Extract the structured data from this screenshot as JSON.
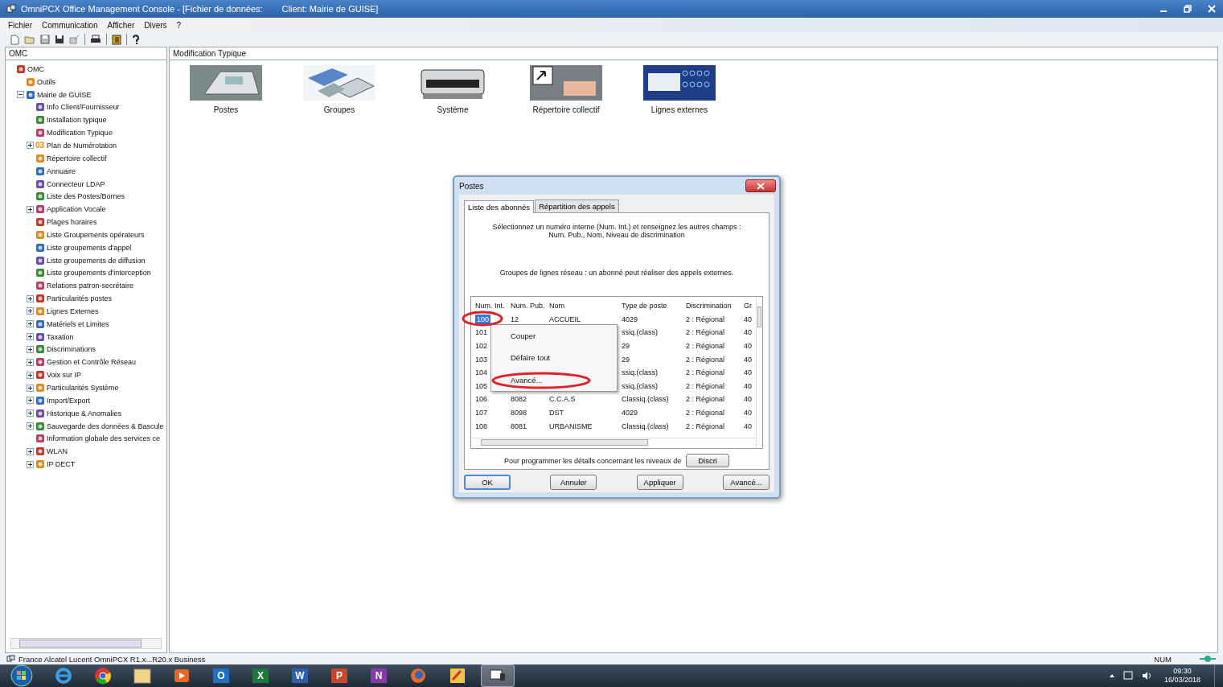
{
  "window": {
    "title": "OmniPCX Office Management Console - [Fichier de données:",
    "client": "Client:  Mairie de GUISE]"
  },
  "menu": [
    "Fichier",
    "Communication",
    "Afficher",
    "Divers",
    "?"
  ],
  "left_panel": {
    "header": "OMC"
  },
  "tree": [
    {
      "label": "OMC",
      "children": [
        {
          "label": "Outils"
        },
        {
          "label": "Mairie de GUISE",
          "expanded": true,
          "children": [
            {
              "label": "Info Client/Fournisseur"
            },
            {
              "label": "Installation typique"
            },
            {
              "label": "Modification Typique"
            },
            {
              "label": "Plan de Numérotation",
              "expanded": false,
              "icon_text": "03"
            },
            {
              "label": "Répertoire collectif"
            },
            {
              "label": "Annuaire"
            },
            {
              "label": "Connecteur LDAP"
            },
            {
              "label": "Liste des Postes/Bornes"
            },
            {
              "label": "Application Vocale",
              "expanded": false
            },
            {
              "label": "Plages horaires"
            },
            {
              "label": "Liste Groupements opérateurs"
            },
            {
              "label": "Liste groupements d'appel"
            },
            {
              "label": "Liste groupements de diffusion"
            },
            {
              "label": "Liste groupements d'interception"
            },
            {
              "label": "Relations patron-secrétaire"
            },
            {
              "label": "Particularités postes",
              "expanded": false
            },
            {
              "label": "Lignes Externes",
              "expanded": false
            },
            {
              "label": "Matériels et Limites",
              "expanded": false
            },
            {
              "label": "Taxation",
              "expanded": false
            },
            {
              "label": "Discriminations",
              "expanded": false
            },
            {
              "label": "Gestion et Contrôle Réseau",
              "expanded": false
            },
            {
              "label": "Voix sur IP",
              "expanded": false
            },
            {
              "label": "Particularités Système",
              "expanded": false
            },
            {
              "label": "Import/Export",
              "expanded": false
            },
            {
              "label": "Historique & Anomalies",
              "expanded": false
            },
            {
              "label": "Sauvegarde des données & Bascule",
              "expanded": false
            },
            {
              "label": "Information globale des services ce"
            },
            {
              "label": "WLAN",
              "expanded": false
            },
            {
              "label": "IP DECT",
              "expanded": false
            }
          ]
        }
      ]
    }
  ],
  "right_panel": {
    "header": "Modification Typique"
  },
  "features": [
    {
      "kind": "phone",
      "label": "Postes"
    },
    {
      "kind": "group",
      "label": "Groupes"
    },
    {
      "kind": "system",
      "label": "Système"
    },
    {
      "kind": "directory",
      "label": "Répertoire collectif"
    },
    {
      "kind": "lines",
      "label": "Lignes externes"
    }
  ],
  "dialog": {
    "title": "Postes",
    "tabs": [
      {
        "label": "Liste des abonnés",
        "selected": true
      },
      {
        "label": "Répartition des appels",
        "selected": false
      }
    ],
    "instructions": [
      "Sélectionnez un numéro interne (Num. Int.) et renseignez les autres champs :",
      "Num. Pub., Nom, Niveau de discrimination"
    ],
    "groups_note": "Groupes de lignes réseau : un abonné peut réaliser des appels externes.",
    "table": {
      "columns": [
        "Num. Int.",
        "Num. Pub.",
        "Nom",
        "Type de poste",
        "Discrimination",
        "Gr"
      ],
      "rows": [
        {
          "cells": [
            "100",
            "12",
            "ACCUEIL",
            "4029",
            "2 : Régional",
            "40"
          ],
          "selected": true
        },
        {
          "cells": [
            "101",
            null,
            null,
            "ssiq.(class)",
            "2 : Régional",
            "40"
          ],
          "selected": false
        },
        {
          "cells": [
            "102",
            null,
            null,
            "29",
            "2 : Régional",
            "40"
          ],
          "selected": false
        },
        {
          "cells": [
            "103",
            null,
            null,
            "29",
            "2 : Régional",
            "40"
          ],
          "selected": false
        },
        {
          "cells": [
            "104",
            null,
            null,
            "ssiq.(class)",
            "2 : Régional",
            "40"
          ],
          "selected": false
        },
        {
          "cells": [
            "105",
            null,
            null,
            "ssiq.(class)",
            "2 : Régional",
            "40"
          ],
          "selected": false
        },
        {
          "cells": [
            "106",
            "8082",
            "C.C.A.S",
            "Classiq.(class)",
            "2 : Régional",
            "40"
          ],
          "selected": false
        },
        {
          "cells": [
            "107",
            "8098",
            "DST",
            "4029",
            "2 : Régional",
            "40"
          ],
          "selected": false
        },
        {
          "cells": [
            "108",
            "8081",
            "URBANISME",
            "Classiq.(class)",
            "2 : Régional",
            "40"
          ],
          "selected": false
        }
      ]
    },
    "context_menu": [
      "Couper",
      "Défaire tout",
      "Avancé..."
    ],
    "discri_note": "Pour programmer les détails concernant les niveaux de",
    "discri_button": "Discri",
    "buttons": [
      {
        "label": "OK",
        "default": true
      },
      {
        "label": "Annuler",
        "default": false
      },
      {
        "label": "Appliquer",
        "default": false
      },
      {
        "label": "Avancé...",
        "default": false
      }
    ]
  },
  "status_bar": {
    "text": "France Alcatel Lucent OmniPCX R1.x...R20.x Business",
    "indicator": "NUM"
  },
  "taskbar": {
    "apps": [
      {
        "kind": "ie",
        "selected": false
      },
      {
        "kind": "chrome",
        "selected": false
      },
      {
        "kind": "folder",
        "selected": false
      },
      {
        "kind": "media",
        "selected": false
      },
      {
        "kind": "office",
        "letter": "O",
        "color": "#1f6fc4",
        "selected": false
      },
      {
        "kind": "office",
        "letter": "X",
        "color": "#1e7a3c",
        "selected": false
      },
      {
        "kind": "office",
        "letter": "W",
        "color": "#2b5fb4",
        "selected": false
      },
      {
        "kind": "office",
        "letter": "P",
        "color": "#c8462a",
        "selected": false
      },
      {
        "kind": "office",
        "letter": "N",
        "color": "#8a3aa8",
        "selected": false
      },
      {
        "kind": "firefox",
        "selected": false
      },
      {
        "kind": "paint",
        "selected": false
      },
      {
        "kind": "remote",
        "selected": true
      }
    ],
    "time": "09:30",
    "date": "16/03/2018"
  }
}
